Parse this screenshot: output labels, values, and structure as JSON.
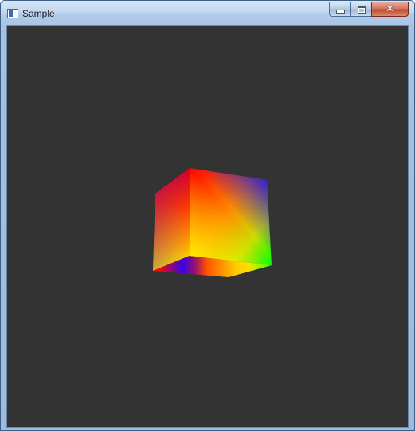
{
  "window": {
    "title": "Sample",
    "icon": "app-window-icon"
  },
  "caption_buttons": {
    "minimize": "minimize-icon",
    "maximize": "maximize-icon",
    "close": "close-icon"
  },
  "viewport": {
    "background": "#333333",
    "content": "rotating-color-cube"
  },
  "colors": {
    "titlebar": "#b9d1ea",
    "close_button": "#c75b43",
    "client_background": "#333333"
  }
}
